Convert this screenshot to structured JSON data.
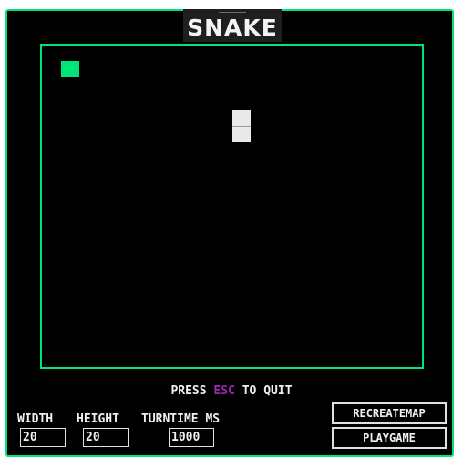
{
  "game": {
    "title": "SNAKE"
  },
  "instructions": {
    "before": "PRESS ",
    "key": "ESC",
    "after": " TO QUIT"
  },
  "settings": {
    "width": {
      "label": "WIDTH",
      "value": "20"
    },
    "height": {
      "label": "HEIGHT",
      "value": "20"
    },
    "turntime": {
      "label": "TURNTIME MS",
      "value": "1000"
    }
  },
  "buttons": {
    "recreate": "RECREATEMAP",
    "play": "PLAYGAME"
  },
  "colors": {
    "accent": "#00e676",
    "esc_key": "#9c27b0",
    "snake": "#e9e9e9",
    "food": "#00e676"
  }
}
